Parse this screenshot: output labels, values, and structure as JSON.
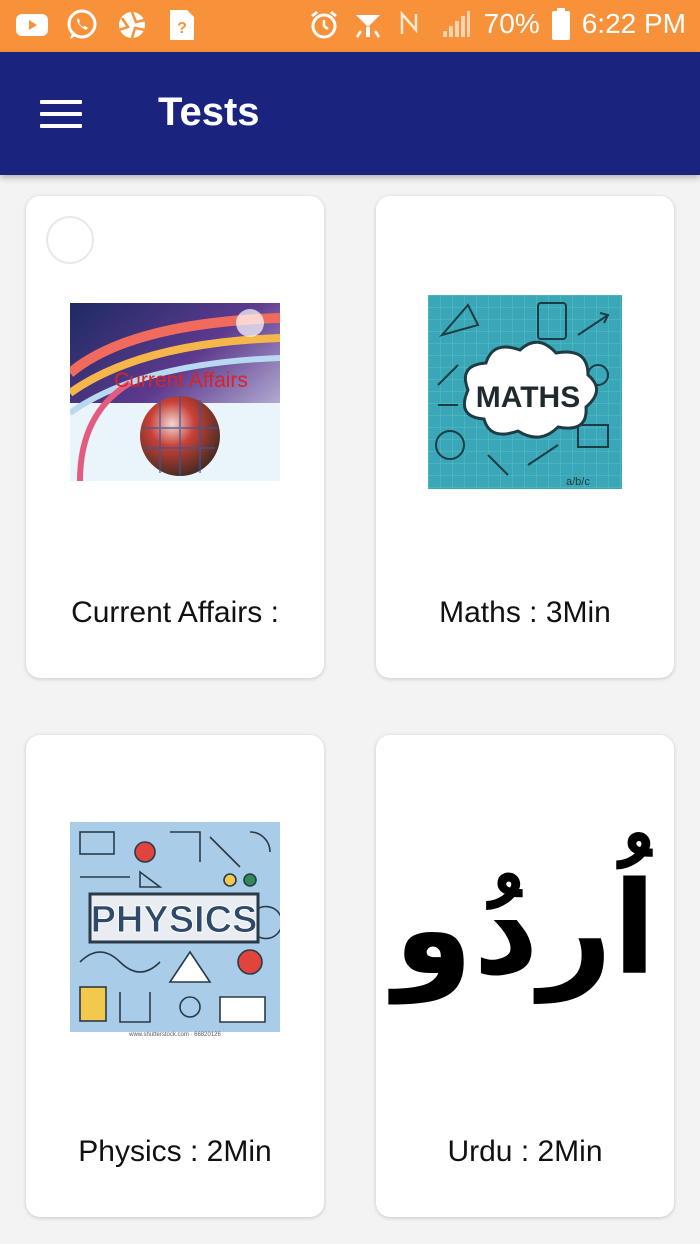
{
  "status_bar": {
    "battery": "70%",
    "time": "6:22 PM",
    "left_icons": [
      "youtube-icon",
      "whatsapp-icon",
      "aperture-icon",
      "help-file-icon"
    ],
    "right_icons": [
      "alarm-icon",
      "wifi-icon",
      "no-signal-icon",
      "signal-bars-icon",
      "battery-icon"
    ]
  },
  "app_bar": {
    "title": "Tests",
    "menu_icon": "hamburger-menu-icon"
  },
  "tests": [
    {
      "label": "Current Affairs :",
      "image_text": "Current Affairs",
      "image": "current-affairs-globe"
    },
    {
      "label": "Maths : 3Min",
      "image_text": "MATHS",
      "image_caption": "a/b/c",
      "image": "maths-cloud"
    },
    {
      "label": "Physics : 2Min",
      "image_text": "PHYSICS",
      "image_caption": "www.shutterstock.com · 66820126",
      "image": "physics-doodles"
    },
    {
      "label": "Urdu : 2Min",
      "image_text": "اُردُو",
      "image": "urdu-calligraphy"
    }
  ],
  "colors": {
    "status_bar": "#f7923a",
    "app_bar": "#1a237e",
    "background": "#f3f3f3",
    "card": "#ffffff"
  }
}
